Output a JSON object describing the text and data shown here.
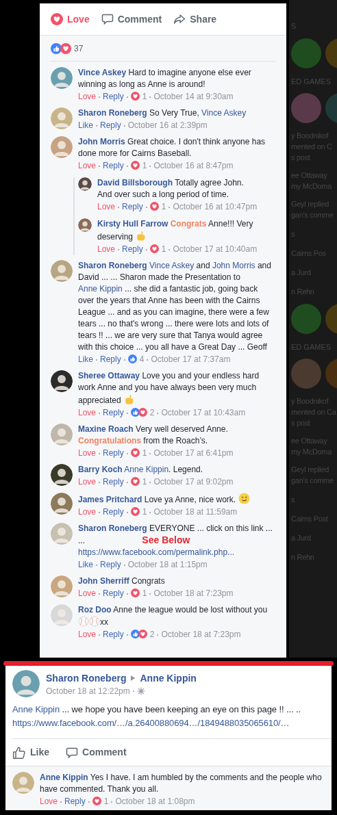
{
  "action_bar": [
    {
      "label": "Love",
      "kind": "love",
      "active": true
    },
    {
      "label": "Comment",
      "kind": "comment",
      "active": false
    },
    {
      "label": "Share",
      "kind": "share",
      "active": false
    }
  ],
  "reactions_summary": {
    "icons": [
      {
        "kind": "like"
      },
      {
        "kind": "love"
      }
    ],
    "count": "37"
  },
  "comments": [
    {
      "body": [
        {
          "kind": "author",
          "text": "Vince Askey"
        },
        {
          "kind": "text",
          "text": "Hard to imagine anyone else ever winning as long as Anne is around!"
        }
      ],
      "action": {
        "label": "Love",
        "reacted": true
      },
      "reply": "Reply",
      "reactions": [
        {
          "kind": "love"
        }
      ],
      "reaction_count": "1",
      "time": "October 14 at 9:30am"
    },
    {
      "body": [
        {
          "kind": "author",
          "text": "Sharon Roneberg"
        },
        {
          "kind": "text",
          "text": "So Very True,"
        },
        {
          "kind": "mention",
          "text": "Vince Askey"
        }
      ],
      "action": {
        "label": "Like",
        "reacted": false
      },
      "reply": "Reply",
      "time": "October 16 at 2:39pm"
    },
    {
      "body": [
        {
          "kind": "author",
          "text": "John Morris"
        },
        {
          "kind": "text",
          "text": "Great choice. I don't think anyone has done more for Cairns Baseball."
        }
      ],
      "action": {
        "label": "Love",
        "reacted": true
      },
      "reply": "Reply",
      "reactions": [
        {
          "kind": "love"
        }
      ],
      "reaction_count": "1",
      "time": "October 16 at 8:47pm",
      "replies": [
        {
          "body": [
            {
              "kind": "author",
              "text": "David Billsborough"
            },
            {
              "kind": "text",
              "text": "Totally agree John. And over such a long period of time."
            }
          ],
          "action": {
            "label": "Love",
            "reacted": true
          },
          "reply": "Reply",
          "reactions": [
            {
              "kind": "love"
            }
          ],
          "reaction_count": "1",
          "time": "October 16 at 10:47pm"
        },
        {
          "body": [
            {
              "kind": "author",
              "text": "Kirsty Hull Farrow"
            },
            {
              "kind": "highlight",
              "text": "Congrats"
            },
            {
              "kind": "text",
              "text": "Anne!!! Very deserving"
            },
            {
              "kind": "hand"
            }
          ],
          "action": {
            "label": "Love",
            "reacted": true
          },
          "reply": "Reply",
          "reactions": [
            {
              "kind": "love"
            }
          ],
          "reaction_count": "1",
          "time": "October 17 at 10:40am"
        }
      ]
    },
    {
      "body": [
        {
          "kind": "author",
          "text": "Sharon Roneberg"
        },
        {
          "kind": "mention",
          "text": "Vince Askey"
        },
        {
          "kind": "text",
          "text": "and"
        },
        {
          "kind": "mention",
          "text": "John Morris"
        },
        {
          "kind": "text",
          "text": "and David ... ... Sharon made the Presentation to"
        },
        {
          "kind": "mention",
          "text": "Anne Kippin"
        },
        {
          "kind": "text",
          "text": "... she did a fantastic job, going back over the years that Anne has been with the Cairns League ... and as you can imagine, there were a few tears ... no that's wrong ... there were lots and lots of tears !! ... we are very sure that Tanya would agree with this choice ... you all have a Great Day ... Geoff"
        }
      ],
      "action": {
        "label": "Like",
        "reacted": false
      },
      "reply": "Reply",
      "reactions": [
        {
          "kind": "like"
        }
      ],
      "reaction_count": "4",
      "time": "October 17 at 7:37am"
    },
    {
      "body": [
        {
          "kind": "author",
          "text": "Sheree Ottaway"
        },
        {
          "kind": "text",
          "text": "Love you and your endless hard work Anne and you have always been very much appreciated"
        },
        {
          "kind": "hand"
        }
      ],
      "action": {
        "label": "Love",
        "reacted": true
      },
      "reply": "Reply",
      "reactions": [
        {
          "kind": "like"
        },
        {
          "kind": "love"
        }
      ],
      "reaction_count": "2",
      "time": "October 17 at 10:43am"
    },
    {
      "body": [
        {
          "kind": "author",
          "text": "Maxine Roach"
        },
        {
          "kind": "text",
          "text": "Very well deserved Anne."
        },
        {
          "kind": "highlight",
          "text": "Congratulations"
        },
        {
          "kind": "text",
          "text": "from the Roach’s."
        }
      ],
      "action": {
        "label": "Love",
        "reacted": true
      },
      "reply": "Reply",
      "reactions": [
        {
          "kind": "love"
        }
      ],
      "reaction_count": "1",
      "time": "October 17 at 6:41pm"
    },
    {
      "body": [
        {
          "kind": "author",
          "text": "Barry Koch"
        },
        {
          "kind": "mention",
          "text": "Anne Kippin"
        },
        {
          "kind": "text",
          "text": ". Legend.",
          "attached": true
        }
      ],
      "action": {
        "label": "Love",
        "reacted": true
      },
      "reply": "Reply",
      "reactions": [
        {
          "kind": "love"
        }
      ],
      "reaction_count": "1",
      "time": "October 17 at 9:02pm"
    },
    {
      "body": [
        {
          "kind": "author",
          "text": "James Pritchard"
        },
        {
          "kind": "text",
          "text": "Love ya Anne, nice work."
        },
        {
          "kind": "wink"
        }
      ],
      "action": {
        "label": "Love",
        "reacted": true
      },
      "reply": "Reply",
      "reactions": [
        {
          "kind": "love"
        }
      ],
      "reaction_count": "1",
      "time": "October 18 at 11:59am"
    },
    {
      "body": [
        {
          "kind": "author",
          "text": "Sharon Roneberg"
        },
        {
          "kind": "text",
          "text": "EVERYONE ... click on this link ... ..."
        },
        {
          "kind": "note",
          "text": "See Below"
        },
        {
          "kind": "link",
          "text": "https://www.facebook.com/permalink.php..."
        }
      ],
      "action": {
        "label": "Like",
        "reacted": false
      },
      "reply": "Reply",
      "time": "October 18 at 1:15pm"
    },
    {
      "body": [
        {
          "kind": "author",
          "text": "John Sherriff"
        },
        {
          "kind": "text",
          "text": "Congrats"
        }
      ],
      "action": {
        "label": "Love",
        "reacted": true
      },
      "reply": "Reply",
      "reactions": [
        {
          "kind": "love"
        }
      ],
      "reaction_count": "1",
      "time": "October 18 at 7:23pm"
    },
    {
      "body": [
        {
          "kind": "author",
          "text": "Roz Doo"
        },
        {
          "kind": "text",
          "text": "Anne the league would be lost without you"
        },
        {
          "kind": "ball"
        },
        {
          "kind": "ball",
          "attached": true
        },
        {
          "kind": "text",
          "text": "xx",
          "attached": true
        }
      ],
      "action": {
        "label": "Love",
        "reacted": true
      },
      "reply": "Reply",
      "reactions": [
        {
          "kind": "like"
        },
        {
          "kind": "love"
        }
      ],
      "reaction_count": "2",
      "time": "October 18 at 7:23pm"
    }
  ],
  "right_column": [
    {
      "kind": "line",
      "text": "S"
    },
    {
      "kind": "apps"
    },
    {
      "kind": "heading",
      "text": "ED GAMES"
    },
    {
      "kind": "apps"
    },
    {
      "kind": "story",
      "lines": [
        "y Boodnikof",
        "mented on C",
        "s post"
      ]
    },
    {
      "kind": "story",
      "lines": [
        "ee Ottaway",
        "my McDoma"
      ]
    },
    {
      "kind": "story",
      "lines": [
        "Geyl replied",
        "gan's comme"
      ]
    },
    {
      "kind": "line",
      "text": "s"
    },
    {
      "kind": "line",
      "text": "Cairns Pos"
    },
    {
      "kind": "line",
      "text": "a Jurd"
    },
    {
      "kind": "line",
      "text": "n Rehn"
    },
    {
      "kind": "apps"
    },
    {
      "kind": "heading",
      "text": "ED GAMES"
    },
    {
      "kind": "apps"
    },
    {
      "kind": "story",
      "lines": [
        "y Boodnikof",
        "mented on Ca",
        "s post"
      ]
    },
    {
      "kind": "story",
      "lines": [
        "ee Ottaway",
        "my McDoma"
      ]
    },
    {
      "kind": "story",
      "lines": [
        "Geyl replied",
        "gan's comme"
      ]
    },
    {
      "kind": "line",
      "text": "s"
    },
    {
      "kind": "line",
      "text": "Cairns Post"
    },
    {
      "kind": "line",
      "text": "a Jurd"
    },
    {
      "kind": "line",
      "text": "n Rehn"
    }
  ],
  "post": {
    "author": "Sharon Roneberg",
    "recipient": "Anne Kippin",
    "time": "October 18 at 12:22pm",
    "body": [
      {
        "kind": "mention",
        "text": "Anne Kippin"
      },
      {
        "kind": "text",
        "text": "... we hope you have been keeping an eye on this page !! ... .."
      }
    ],
    "link": "https://www.facebook.com/…/a.26400880694…/1849488035065610/…",
    "actions": [
      {
        "label": "Like",
        "kind": "like"
      },
      {
        "label": "Comment",
        "kind": "comment"
      }
    ],
    "comment": {
      "body": [
        {
          "kind": "author",
          "text": "Anne Kippin"
        },
        {
          "kind": "text",
          "text": "Yes I have. I am humbled by the comments and the people who have commented. Thank you all."
        }
      ],
      "action": {
        "label": "Love",
        "reacted": true
      },
      "reply": "Reply",
      "reactions": [
        {
          "kind": "love"
        }
      ],
      "reaction_count": "1",
      "time": "October 18 at 1:08pm"
    }
  }
}
